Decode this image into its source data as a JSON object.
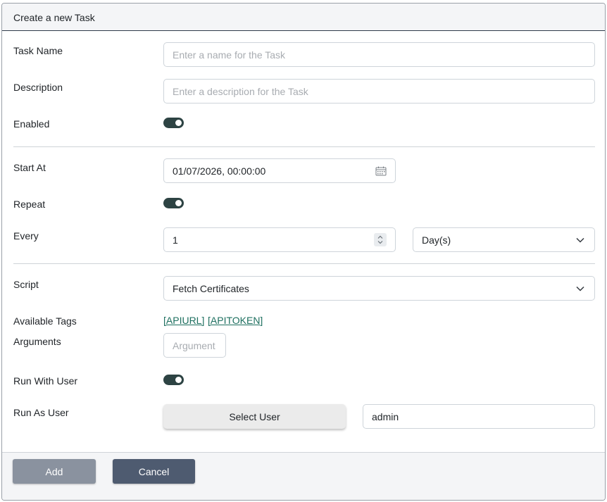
{
  "dialog": {
    "title": "Create a new Task"
  },
  "form": {
    "task_name": {
      "label": "Task Name",
      "placeholder": "Enter a name for the Task",
      "value": ""
    },
    "description": {
      "label": "Description",
      "placeholder": "Enter a description for the Task",
      "value": ""
    },
    "enabled": {
      "label": "Enabled",
      "on": true
    },
    "start_at": {
      "label": "Start At",
      "value": "01/07/2026, 00:00:00"
    },
    "repeat": {
      "label": "Repeat",
      "on": true
    },
    "every": {
      "label": "Every",
      "value": "1",
      "unit": "Day(s)"
    },
    "script": {
      "label": "Script",
      "value": "Fetch Certificates"
    },
    "available_tags": {
      "label": "Available Tags",
      "tags": [
        "[APIURL]",
        "[APITOKEN]"
      ]
    },
    "arguments": {
      "label": "Arguments",
      "placeholder": "Argument",
      "value": ""
    },
    "run_with_user": {
      "label": "Run With User",
      "on": true
    },
    "run_as_user": {
      "label": "Run As User",
      "button": "Select User",
      "value": "admin"
    }
  },
  "footer": {
    "add_label": "Add",
    "cancel_label": "Cancel"
  },
  "colors": {
    "toggle_on": "#2d4343",
    "tag_link": "#1d6f5f",
    "cancel_bg": "#4e5b70",
    "add_bg": "#8a929f"
  },
  "icons": {
    "date_picker": "calendar-icon",
    "number_spin": "spinner-icon",
    "select": "chevron-down-icon"
  }
}
